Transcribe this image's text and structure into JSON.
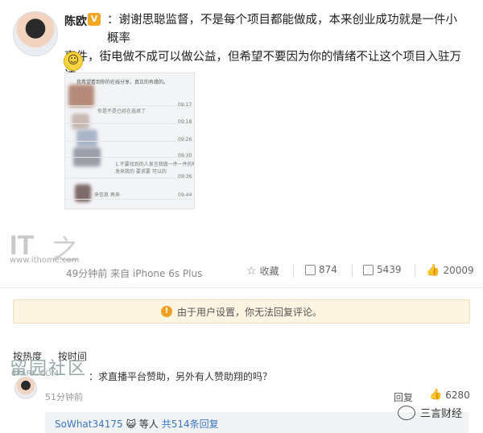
{
  "post": {
    "author": "陈欧",
    "verified_badge": "V",
    "text_line1": "：谢谢思聪监督，不是每个项目都能做成，本来创业成功就是一件小概率",
    "text_line2": "事件，街电做不成可以做公益，但希望不要因为你的情绪不让这个项目入驻万达",
    "emoji": "☺",
    "time_source": "49分钟前 来自 iPhone 6s Plus",
    "actions": {
      "favorite": "收藏",
      "repost_count": "874",
      "comment_count": "5439",
      "like_count": "20009"
    }
  },
  "thumbnail": {
    "header": "我希望看到你的在线分享，真正的有缘的。",
    "rows": [
      {
        "text": "你是不是已经在选择了",
        "time": "09:17"
      },
      {
        "text": "",
        "time": "09:18"
      },
      {
        "text": "",
        "time": "09:26"
      },
      {
        "text": "",
        "time": "09:30"
      },
      {
        "text": "1.不要找到的人发言我做一件一件的吗",
        "time": ""
      },
      {
        "text": "发来我的 要求要 可以的",
        "time": ""
      },
      {
        "text": "",
        "time": "09:36"
      },
      {
        "text": "来信息 再来",
        "time": "09:44"
      }
    ]
  },
  "watermark": {
    "brand": "IT",
    "brand_char": "之",
    "url": "www.ithome.com",
    "forum_chars": "留园社区",
    "forum_site": "6PARK.COM"
  },
  "notice": "由于用户设置，你无法回复评论。",
  "tabs": {
    "hot": "按热度",
    "time": "按时间"
  },
  "comment": {
    "text": "：求直播平台赞助，另外有人赞助翔的吗？",
    "time": "51分钟前",
    "reply": "回复",
    "like_count": "6280"
  },
  "sub_reply": {
    "name": "SoWhat34175",
    "emoji": "😺",
    "middle": "等人",
    "count_text": "共514条回复"
  },
  "wechat_label": "三言财经"
}
